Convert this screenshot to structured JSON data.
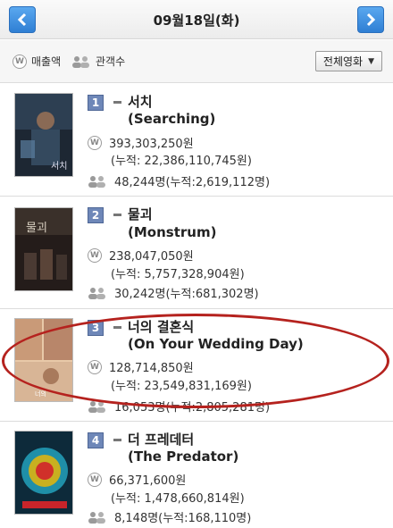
{
  "header": {
    "date": "09월18일(화)"
  },
  "filters": {
    "sales_label": "매출액",
    "audience_label": "관객수",
    "select_value": "전체영화"
  },
  "movies": [
    {
      "rank": "1",
      "title_ko": "서치",
      "title_en": "(Searching)",
      "sales": "393,303,250원",
      "cumulative_sales": "(누적: 22,386,110,745원)",
      "audience": "48,244명(누적:2,619,112명)"
    },
    {
      "rank": "2",
      "title_ko": "물괴",
      "title_en": "(Monstrum)",
      "sales": "238,047,050원",
      "cumulative_sales": "(누적: 5,757,328,904원)",
      "audience": "30,242명(누적:681,302명)"
    },
    {
      "rank": "3",
      "title_ko": "너의 결혼식",
      "title_en": "(On Your Wedding Day)",
      "sales": "128,714,850원",
      "cumulative_sales": "(누적: 23,549,831,169원)",
      "audience": "16,053명(누적:2,805,281명)"
    },
    {
      "rank": "4",
      "title_ko": "더 프레데터",
      "title_en": "(The Predator)",
      "sales": "66,371,600원",
      "cumulative_sales": "(누적: 1,478,660,814원)",
      "audience": "8,148명(누적:168,110명)"
    }
  ],
  "colors": {
    "nav_button": "#2f7fd4",
    "rank_badge": "#6e87b8",
    "highlight_ring": "#b5221e"
  },
  "icons": {
    "sales": "w-coin-icon",
    "audience": "people-icon"
  }
}
